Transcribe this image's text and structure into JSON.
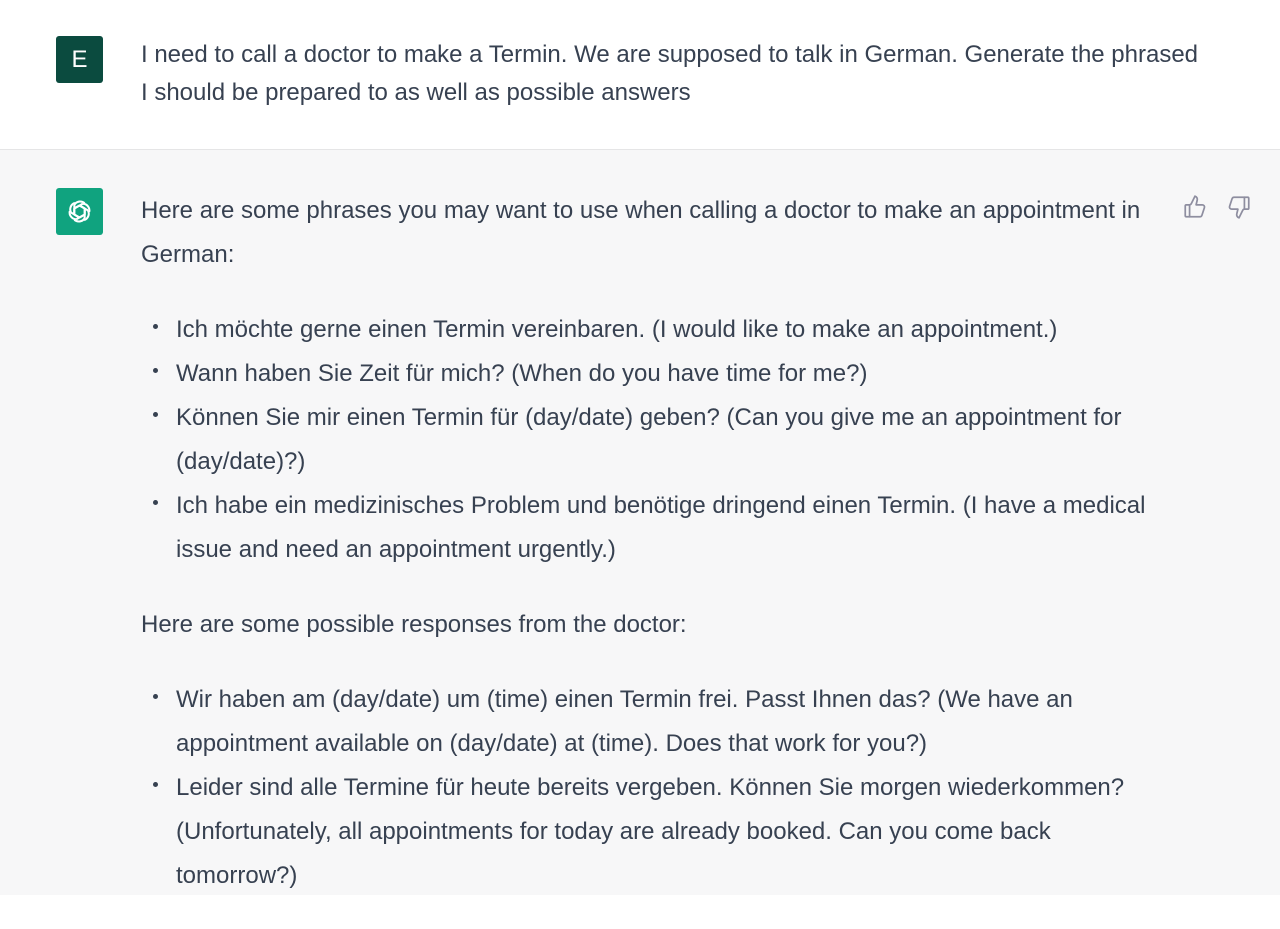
{
  "user_message": {
    "avatar_letter": "E",
    "text": "I need to call a doctor to make a Termin. We are supposed to talk in German. Generate the phrased I should be prepared to as well as possible answers"
  },
  "assistant_message": {
    "intro": "Here are some phrases you may want to use when calling a doctor to make an appointment in German:",
    "phrases": [
      "Ich möchte gerne einen Termin vereinbaren. (I would like to make an appointment.)",
      "Wann haben Sie Zeit für mich? (When do you have time for me?)",
      "Können Sie mir einen Termin für (day/date) geben? (Can you give me an appointment for (day/date)?)",
      "Ich habe ein medizinisches Problem und benötige dringend einen Termin. (I have a medical issue and need an appointment urgently.)"
    ],
    "responses_intro": "Here are some possible responses from the doctor:",
    "responses": [
      "Wir haben am (day/date) um (time) einen Termin frei. Passt Ihnen das? (We have an appointment available on (day/date) at (time). Does that work for you?)",
      "Leider sind alle Termine für heute bereits vergeben. Können Sie morgen wiederkommen? (Unfortunately, all appointments for today are already booked. Can you come back tomorrow?)"
    ]
  },
  "icons": {
    "assistant_logo": "openai-logo-icon",
    "like": "thumbs-up-icon",
    "dislike": "thumbs-down-icon"
  },
  "colors": {
    "user_avatar": "#0b4b3f",
    "assistant_avatar": "#10a37f",
    "assistant_background": "#f7f7f8",
    "text": "#374151"
  }
}
